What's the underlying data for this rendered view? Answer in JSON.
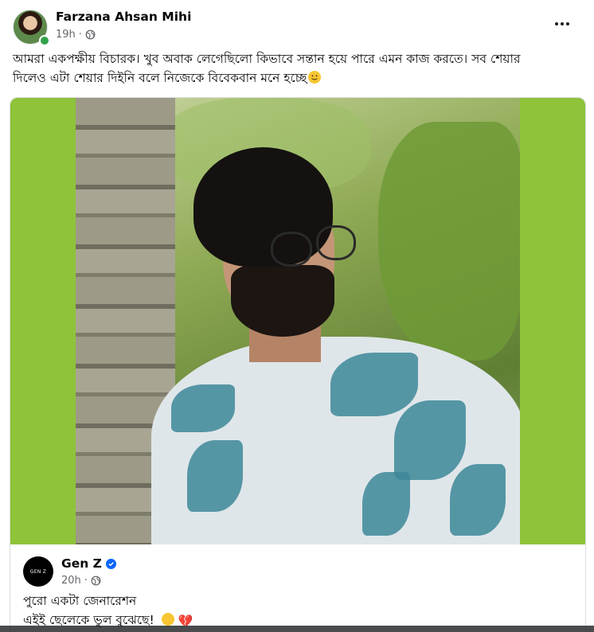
{
  "post": {
    "author": "Farzana Ahsan Mihi",
    "time": "19h",
    "separator": "·",
    "caption": "আমরা একপক্ষীয় বিচারক। খুব অবাক লেগেছিলো কিভাবে সন্তান হয়ে পারে এমন কাজ করতে।  সব শেয়ার দিলেও এটা শেয়ার দিইনি বলে নিজেকে বিবেকবান মনে হচ্ছে",
    "icons": [
      "globe-icon",
      "more-icon",
      "smile-emoji"
    ]
  },
  "shared": {
    "page_name": "Gen Z",
    "avatar_text": "GEN Z",
    "time": "20h",
    "separator": "·",
    "line1": "পুরো একটা জেনারেশন",
    "line2": "এইই ছেলেকে  ভুল বুঝেছে!",
    "icons": [
      "verified-icon",
      "globe-icon",
      "neutral-face-emoji",
      "broken-heart-emoji"
    ],
    "heart_glyph": "💔"
  },
  "colors": {
    "photo_frame": "#8fc33a",
    "meta_text": "#65676b",
    "verified": "#0866ff",
    "online": "#31a24c"
  }
}
